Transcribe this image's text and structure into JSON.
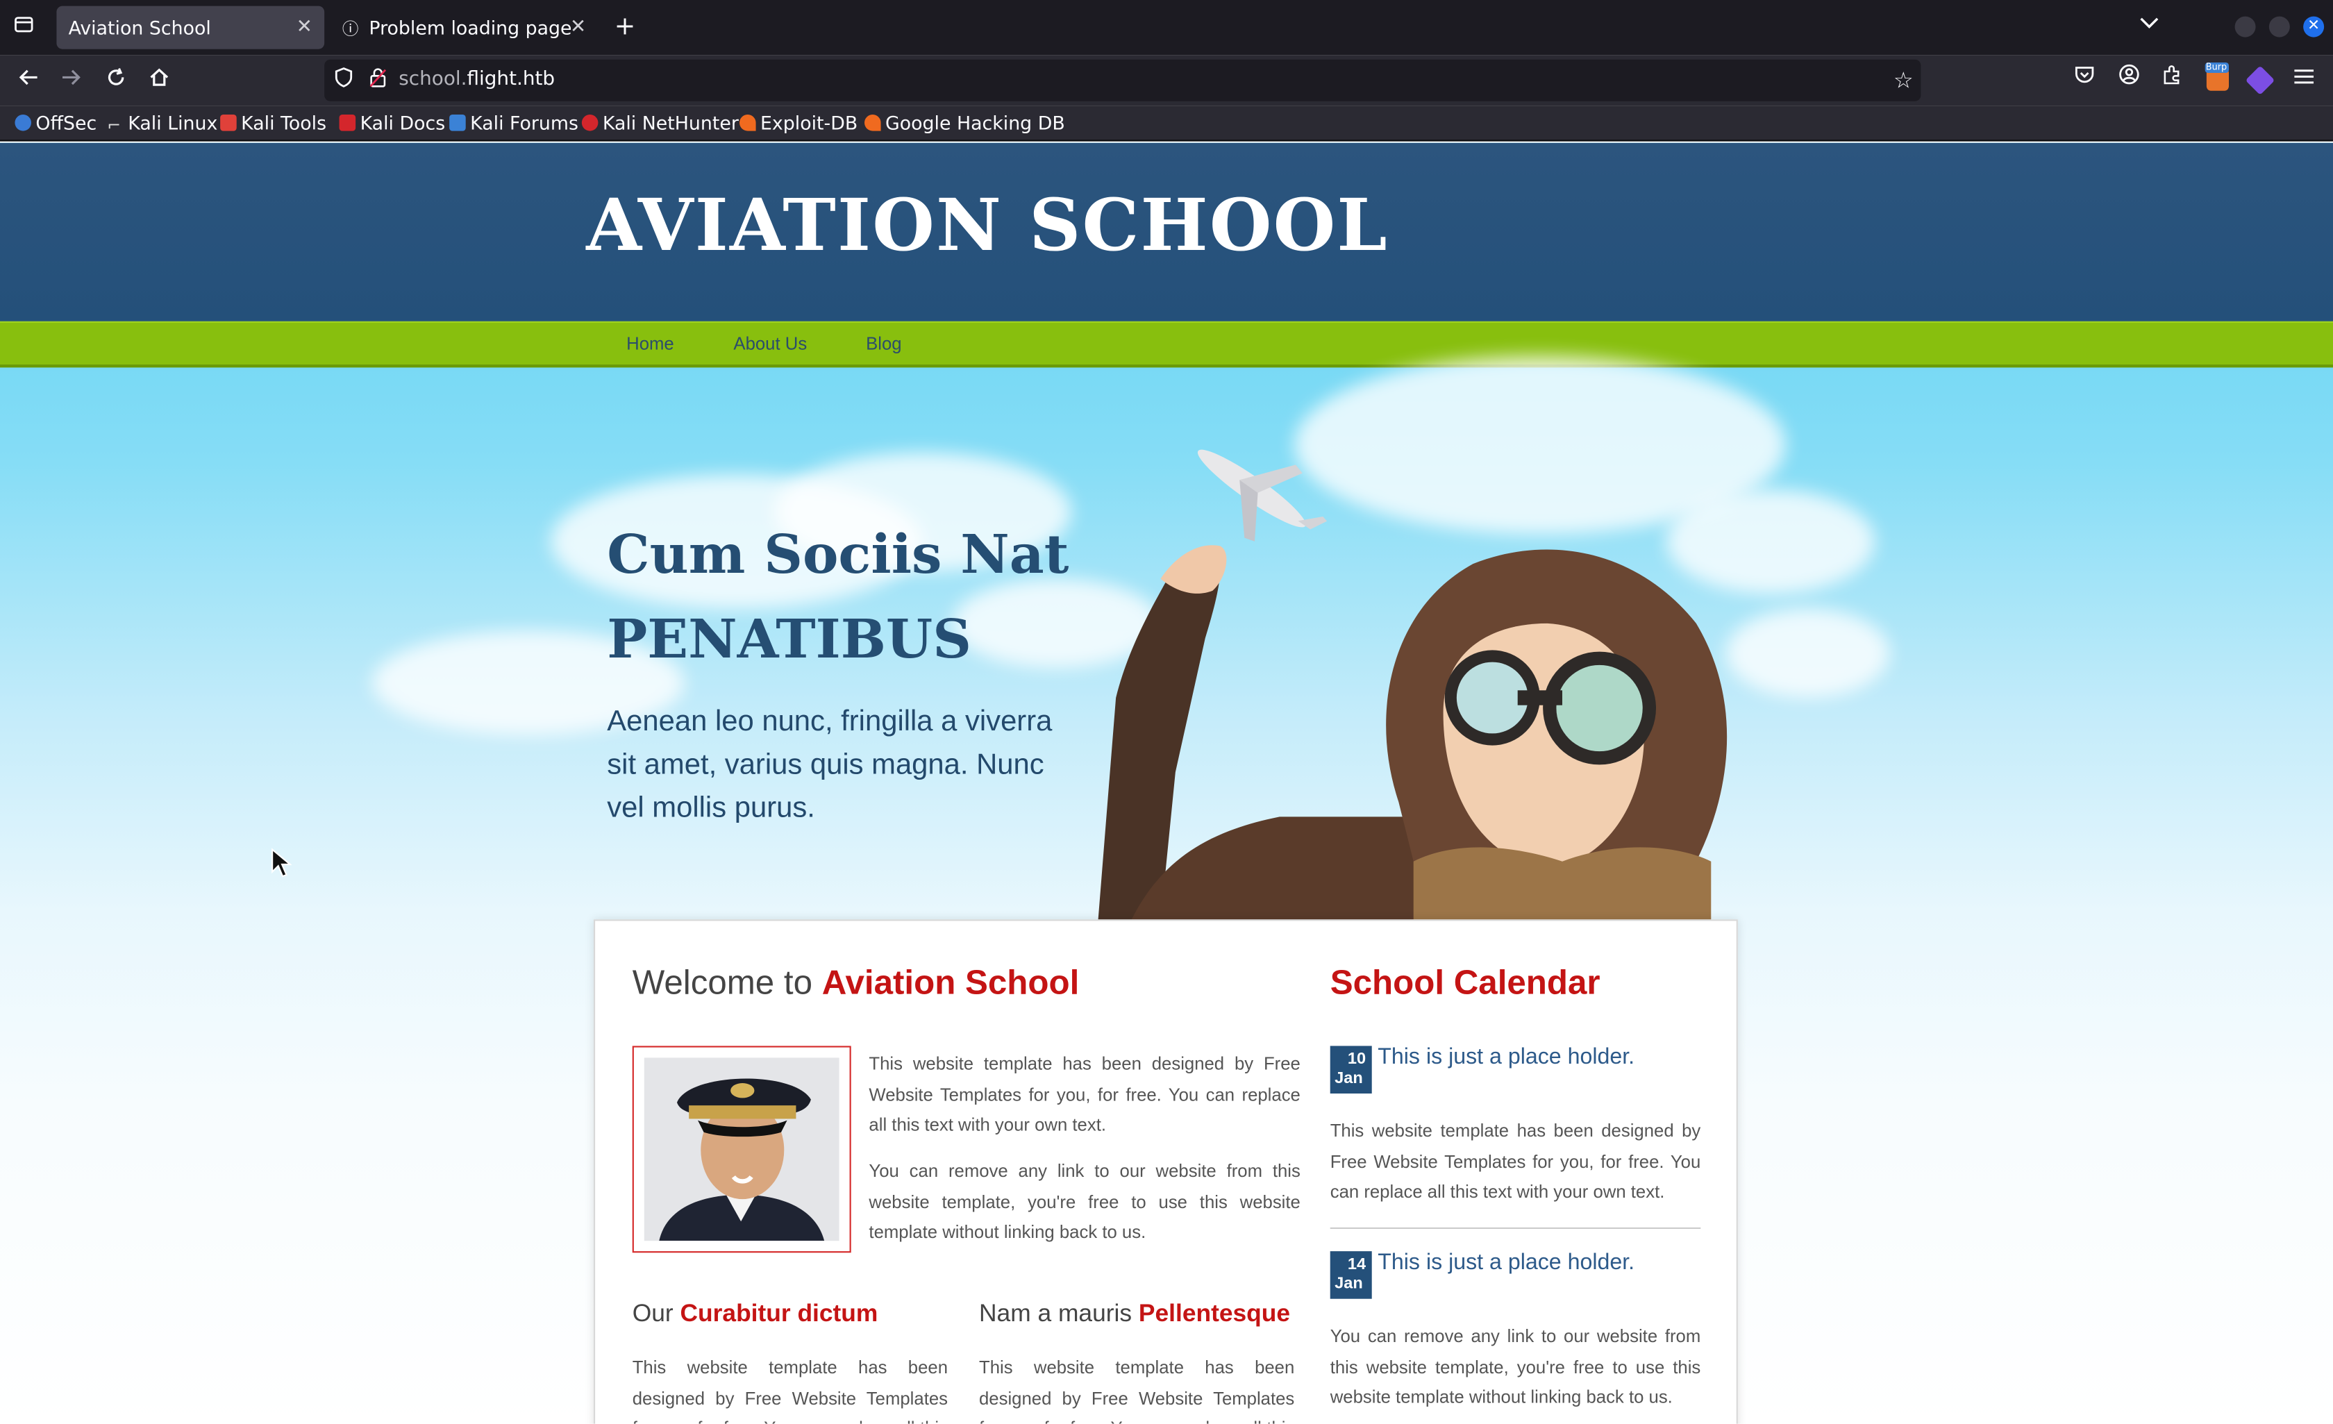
{
  "browser": {
    "tabs": [
      {
        "title": "Aviation School",
        "active": true
      },
      {
        "title": "Problem loading page",
        "active": false
      }
    ],
    "url": {
      "domain_prefix": "school.",
      "domain_main": "flight.htb"
    },
    "bookmarks": [
      {
        "label": "OffSec",
        "icon": "offsec-icon",
        "color": "#3a7bd5"
      },
      {
        "label": "Kali Linux",
        "icon": "kali-dragon-icon",
        "color": "#dddddd"
      },
      {
        "label": "Kali Tools",
        "icon": "kali-tools-icon",
        "color": "#e0413a"
      },
      {
        "label": "Kali Docs",
        "icon": "kali-docs-icon",
        "color": "#d4262c"
      },
      {
        "label": "Kali Forums",
        "icon": "kali-forums-icon",
        "color": "#3b82d6"
      },
      {
        "label": "Kali NetHunter",
        "icon": "nethunter-icon",
        "color": "#d4262c"
      },
      {
        "label": "Exploit-DB",
        "icon": "exploit-db-icon",
        "color": "#f06a1f"
      },
      {
        "label": "Google Hacking DB",
        "icon": "ghdb-icon",
        "color": "#f06a1f"
      }
    ]
  },
  "site": {
    "title": "AVIATION SCHOOL",
    "nav": [
      "Home",
      "About Us",
      "Blog"
    ],
    "hero": {
      "headline_line1": "Cum Sociis Nat",
      "headline_line2": "PENATIBUS",
      "text": "Aenean leo nunc, fringilla a viverra sit amet, varius quis magna. Nunc vel mollis purus."
    },
    "welcome": {
      "prefix": "Welcome to",
      "highlight": "Aviation School",
      "paragraphs": [
        "This website template has been designed by Free Website Templates for you, for free. You can replace all this text with your own text.",
        "You can remove any link to our website from this website template, you're free to use this website template without linking back to us."
      ]
    },
    "sub_sections": [
      {
        "prefix": "Our",
        "highlight": "Curabitur dictum",
        "text": "This website template has been designed by Free Website Templates for you, for free. You can replace all this text with your own text."
      },
      {
        "prefix": "Nam a mauris",
        "highlight": "Pellentesque",
        "text": "This website template has been designed by Free Website Templates for you, for free. You can replace all this text with your own text."
      }
    ],
    "calendar": {
      "title": "School Calendar",
      "events": [
        {
          "day": "10",
          "month": "Jan",
          "title": "This is just a place holder.",
          "text": "This website template has been designed by Free Website Templates for you, for free. You can replace all this text with your own text."
        },
        {
          "day": "14",
          "month": "Jan",
          "title": "This is just a place holder.",
          "text": "You can remove any link to our website from this website template, you're free to use this website template without linking back to us."
        }
      ]
    }
  }
}
